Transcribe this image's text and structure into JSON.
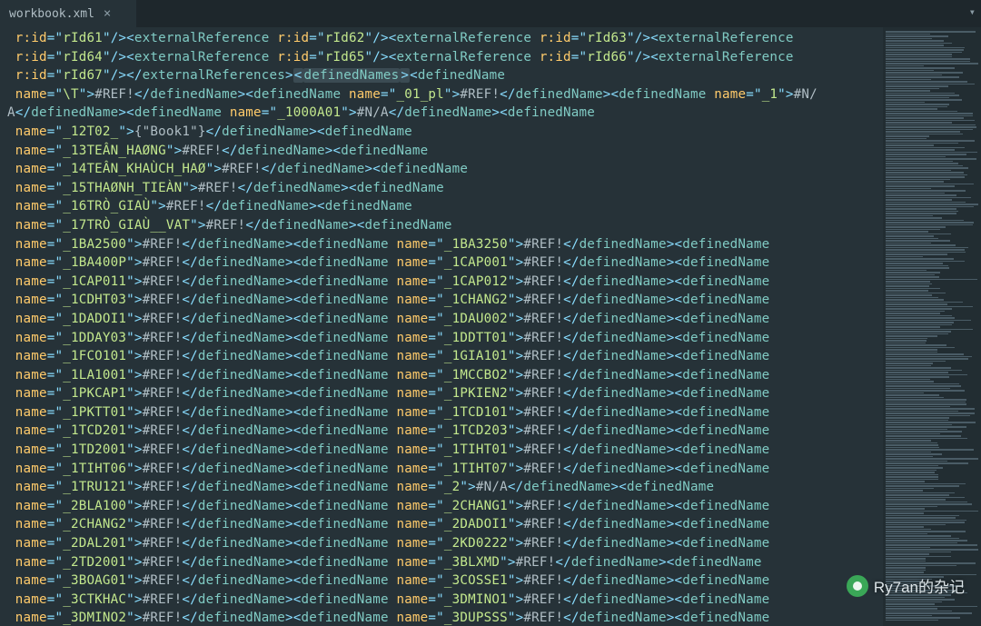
{
  "tab": {
    "title": "workbook.xml"
  },
  "watermark": "Ry7an的杂记",
  "highlighted_segment": "<definedNames>",
  "colors": {
    "background": "#263238",
    "tab_bar": "#1e272c",
    "text": "#b0bec5",
    "tag": "#80cbc4",
    "attr_name": "#ffcb6b",
    "attr_val": "#c3e88d",
    "punct": "#89ddff",
    "highlight": "#3b4b53"
  },
  "tokens": [
    {
      "t": "attr",
      "name": "r:id",
      "val": "rId61"
    },
    {
      "t": "closeSelf"
    },
    {
      "t": "open",
      "name": "externalReference"
    },
    {
      "t": "attr",
      "name": "r:id",
      "val": "rId62"
    },
    {
      "t": "closeSelf"
    },
    {
      "t": "open",
      "name": "externalReference"
    },
    {
      "t": "attr",
      "name": "r:id",
      "val": "rId63"
    },
    {
      "t": "closeSelf"
    },
    {
      "t": "open",
      "name": "externalReference"
    },
    {
      "t": "br"
    },
    {
      "t": "attr",
      "name": "r:id",
      "val": "rId64"
    },
    {
      "t": "closeSelf"
    },
    {
      "t": "open",
      "name": "externalReference"
    },
    {
      "t": "attr",
      "name": "r:id",
      "val": "rId65"
    },
    {
      "t": "closeSelf"
    },
    {
      "t": "open",
      "name": "externalReference"
    },
    {
      "t": "attr",
      "name": "r:id",
      "val": "rId66"
    },
    {
      "t": "closeSelf"
    },
    {
      "t": "open",
      "name": "externalReference"
    },
    {
      "t": "br"
    },
    {
      "t": "attr",
      "name": "r:id",
      "val": "rId67"
    },
    {
      "t": "closeSelf"
    },
    {
      "t": "closeTag",
      "name": "externalReferences"
    },
    {
      "t": "open",
      "name": "definedNames",
      "hl": true
    },
    {
      "t": "gt",
      "hl": true
    },
    {
      "t": "open",
      "name": "definedName"
    },
    {
      "t": "br"
    },
    {
      "t": "attr",
      "name": "name",
      "val": "\\T"
    },
    {
      "t": "gt"
    },
    {
      "t": "text",
      "v": "#REF!"
    },
    {
      "t": "closeTag",
      "name": "definedName"
    },
    {
      "t": "open",
      "name": "definedName"
    },
    {
      "t": "attr",
      "name": "name",
      "val": "_01_pl"
    },
    {
      "t": "gt"
    },
    {
      "t": "text",
      "v": "#REF!"
    },
    {
      "t": "closeTag",
      "name": "definedName"
    },
    {
      "t": "open",
      "name": "definedName"
    },
    {
      "t": "attr",
      "name": "name",
      "val": "_1"
    },
    {
      "t": "gt"
    },
    {
      "t": "text",
      "v": "#N/"
    },
    {
      "t": "br"
    },
    {
      "t": "text",
      "v": "A"
    },
    {
      "t": "closeTag",
      "name": "definedName"
    },
    {
      "t": "open",
      "name": "definedName"
    },
    {
      "t": "attr",
      "name": "name",
      "val": "_1000A01"
    },
    {
      "t": "gt"
    },
    {
      "t": "text",
      "v": "#N/A"
    },
    {
      "t": "closeTag",
      "name": "definedName"
    },
    {
      "t": "open",
      "name": "definedName"
    },
    {
      "t": "br"
    },
    {
      "t": "attr",
      "name": "name",
      "val": "_12T02_"
    },
    {
      "t": "gt"
    },
    {
      "t": "text",
      "v": "{\"Book1\"}"
    },
    {
      "t": "closeTag",
      "name": "definedName"
    },
    {
      "t": "open",
      "name": "definedName"
    },
    {
      "t": "br"
    },
    {
      "t": "attr",
      "name": "name",
      "val": "_13TEÂN_HAØNG"
    },
    {
      "t": "gt"
    },
    {
      "t": "text",
      "v": "#REF!"
    },
    {
      "t": "closeTag",
      "name": "definedName"
    },
    {
      "t": "open",
      "name": "definedName"
    },
    {
      "t": "br"
    },
    {
      "t": "attr",
      "name": "name",
      "val": "_14TEÂN_KHAÙCH_HAØ"
    },
    {
      "t": "gt"
    },
    {
      "t": "text",
      "v": "#REF!"
    },
    {
      "t": "closeTag",
      "name": "definedName"
    },
    {
      "t": "open",
      "name": "definedName"
    },
    {
      "t": "br"
    },
    {
      "t": "attr",
      "name": "name",
      "val": "_15THAØNH_TIEÀN"
    },
    {
      "t": "gt"
    },
    {
      "t": "text",
      "v": "#REF!"
    },
    {
      "t": "closeTag",
      "name": "definedName"
    },
    {
      "t": "open",
      "name": "definedName"
    },
    {
      "t": "br"
    },
    {
      "t": "attr",
      "name": "name",
      "val": "_16TRÒ_GIAÙ"
    },
    {
      "t": "gt"
    },
    {
      "t": "text",
      "v": "#REF!"
    },
    {
      "t": "closeTag",
      "name": "definedName"
    },
    {
      "t": "open",
      "name": "definedName"
    },
    {
      "t": "br"
    },
    {
      "t": "attr",
      "name": "name",
      "val": "_17TRÒ_GIAÙ__VAT"
    },
    {
      "t": "gt"
    },
    {
      "t": "text",
      "v": "#REF!"
    },
    {
      "t": "closeTag",
      "name": "definedName"
    },
    {
      "t": "open",
      "name": "definedName"
    },
    {
      "t": "br"
    },
    {
      "t": "attr",
      "name": "name",
      "val": "_1BA2500"
    },
    {
      "t": "gt"
    },
    {
      "t": "text",
      "v": "#REF!"
    },
    {
      "t": "closeTag",
      "name": "definedName"
    },
    {
      "t": "open",
      "name": "definedName"
    },
    {
      "t": "attr",
      "name": "name",
      "val": "_1BA3250"
    },
    {
      "t": "gt"
    },
    {
      "t": "text",
      "v": "#REF!"
    },
    {
      "t": "closeTag",
      "name": "definedName"
    },
    {
      "t": "open",
      "name": "definedName"
    },
    {
      "t": "br"
    },
    {
      "t": "attr",
      "name": "name",
      "val": "_1BA400P"
    },
    {
      "t": "gt"
    },
    {
      "t": "text",
      "v": "#REF!"
    },
    {
      "t": "closeTag",
      "name": "definedName"
    },
    {
      "t": "open",
      "name": "definedName"
    },
    {
      "t": "attr",
      "name": "name",
      "val": "_1CAP001"
    },
    {
      "t": "gt"
    },
    {
      "t": "text",
      "v": "#REF!"
    },
    {
      "t": "closeTag",
      "name": "definedName"
    },
    {
      "t": "open",
      "name": "definedName"
    },
    {
      "t": "br"
    },
    {
      "t": "attr",
      "name": "name",
      "val": "_1CAP011"
    },
    {
      "t": "gt"
    },
    {
      "t": "text",
      "v": "#REF!"
    },
    {
      "t": "closeTag",
      "name": "definedName"
    },
    {
      "t": "open",
      "name": "definedName"
    },
    {
      "t": "attr",
      "name": "name",
      "val": "_1CAP012"
    },
    {
      "t": "gt"
    },
    {
      "t": "text",
      "v": "#REF!"
    },
    {
      "t": "closeTag",
      "name": "definedName"
    },
    {
      "t": "open",
      "name": "definedName"
    },
    {
      "t": "br"
    },
    {
      "t": "attr",
      "name": "name",
      "val": "_1CDHT03"
    },
    {
      "t": "gt"
    },
    {
      "t": "text",
      "v": "#REF!"
    },
    {
      "t": "closeTag",
      "name": "definedName"
    },
    {
      "t": "open",
      "name": "definedName"
    },
    {
      "t": "attr",
      "name": "name",
      "val": "_1CHANG2"
    },
    {
      "t": "gt"
    },
    {
      "t": "text",
      "v": "#REF!"
    },
    {
      "t": "closeTag",
      "name": "definedName"
    },
    {
      "t": "open",
      "name": "definedName"
    },
    {
      "t": "br"
    },
    {
      "t": "attr",
      "name": "name",
      "val": "_1DADOI1"
    },
    {
      "t": "gt"
    },
    {
      "t": "text",
      "v": "#REF!"
    },
    {
      "t": "closeTag",
      "name": "definedName"
    },
    {
      "t": "open",
      "name": "definedName"
    },
    {
      "t": "attr",
      "name": "name",
      "val": "_1DAU002"
    },
    {
      "t": "gt"
    },
    {
      "t": "text",
      "v": "#REF!"
    },
    {
      "t": "closeTag",
      "name": "definedName"
    },
    {
      "t": "open",
      "name": "definedName"
    },
    {
      "t": "br"
    },
    {
      "t": "attr",
      "name": "name",
      "val": "_1DDAY03"
    },
    {
      "t": "gt"
    },
    {
      "t": "text",
      "v": "#REF!"
    },
    {
      "t": "closeTag",
      "name": "definedName"
    },
    {
      "t": "open",
      "name": "definedName"
    },
    {
      "t": "attr",
      "name": "name",
      "val": "_1DDTT01"
    },
    {
      "t": "gt"
    },
    {
      "t": "text",
      "v": "#REF!"
    },
    {
      "t": "closeTag",
      "name": "definedName"
    },
    {
      "t": "open",
      "name": "definedName"
    },
    {
      "t": "br"
    },
    {
      "t": "attr",
      "name": "name",
      "val": "_1FCO101"
    },
    {
      "t": "gt"
    },
    {
      "t": "text",
      "v": "#REF!"
    },
    {
      "t": "closeTag",
      "name": "definedName"
    },
    {
      "t": "open",
      "name": "definedName"
    },
    {
      "t": "attr",
      "name": "name",
      "val": "_1GIA101"
    },
    {
      "t": "gt"
    },
    {
      "t": "text",
      "v": "#REF!"
    },
    {
      "t": "closeTag",
      "name": "definedName"
    },
    {
      "t": "open",
      "name": "definedName"
    },
    {
      "t": "br"
    },
    {
      "t": "attr",
      "name": "name",
      "val": "_1LA1001"
    },
    {
      "t": "gt"
    },
    {
      "t": "text",
      "v": "#REF!"
    },
    {
      "t": "closeTag",
      "name": "definedName"
    },
    {
      "t": "open",
      "name": "definedName"
    },
    {
      "t": "attr",
      "name": "name",
      "val": "_1MCCBO2"
    },
    {
      "t": "gt"
    },
    {
      "t": "text",
      "v": "#REF!"
    },
    {
      "t": "closeTag",
      "name": "definedName"
    },
    {
      "t": "open",
      "name": "definedName"
    },
    {
      "t": "br"
    },
    {
      "t": "attr",
      "name": "name",
      "val": "_1PKCAP1"
    },
    {
      "t": "gt"
    },
    {
      "t": "text",
      "v": "#REF!"
    },
    {
      "t": "closeTag",
      "name": "definedName"
    },
    {
      "t": "open",
      "name": "definedName"
    },
    {
      "t": "attr",
      "name": "name",
      "val": "_1PKIEN2"
    },
    {
      "t": "gt"
    },
    {
      "t": "text",
      "v": "#REF!"
    },
    {
      "t": "closeTag",
      "name": "definedName"
    },
    {
      "t": "open",
      "name": "definedName"
    },
    {
      "t": "br"
    },
    {
      "t": "attr",
      "name": "name",
      "val": "_1PKTT01"
    },
    {
      "t": "gt"
    },
    {
      "t": "text",
      "v": "#REF!"
    },
    {
      "t": "closeTag",
      "name": "definedName"
    },
    {
      "t": "open",
      "name": "definedName"
    },
    {
      "t": "attr",
      "name": "name",
      "val": "_1TCD101"
    },
    {
      "t": "gt"
    },
    {
      "t": "text",
      "v": "#REF!"
    },
    {
      "t": "closeTag",
      "name": "definedName"
    },
    {
      "t": "open",
      "name": "definedName"
    },
    {
      "t": "br"
    },
    {
      "t": "attr",
      "name": "name",
      "val": "_1TCD201"
    },
    {
      "t": "gt"
    },
    {
      "t": "text",
      "v": "#REF!"
    },
    {
      "t": "closeTag",
      "name": "definedName"
    },
    {
      "t": "open",
      "name": "definedName"
    },
    {
      "t": "attr",
      "name": "name",
      "val": "_1TCD203"
    },
    {
      "t": "gt"
    },
    {
      "t": "text",
      "v": "#REF!"
    },
    {
      "t": "closeTag",
      "name": "definedName"
    },
    {
      "t": "open",
      "name": "definedName"
    },
    {
      "t": "br"
    },
    {
      "t": "attr",
      "name": "name",
      "val": "_1TD2001"
    },
    {
      "t": "gt"
    },
    {
      "t": "text",
      "v": "#REF!"
    },
    {
      "t": "closeTag",
      "name": "definedName"
    },
    {
      "t": "open",
      "name": "definedName"
    },
    {
      "t": "attr",
      "name": "name",
      "val": "_1TIHT01"
    },
    {
      "t": "gt"
    },
    {
      "t": "text",
      "v": "#REF!"
    },
    {
      "t": "closeTag",
      "name": "definedName"
    },
    {
      "t": "open",
      "name": "definedName"
    },
    {
      "t": "br"
    },
    {
      "t": "attr",
      "name": "name",
      "val": "_1TIHT06"
    },
    {
      "t": "gt"
    },
    {
      "t": "text",
      "v": "#REF!"
    },
    {
      "t": "closeTag",
      "name": "definedName"
    },
    {
      "t": "open",
      "name": "definedName"
    },
    {
      "t": "attr",
      "name": "name",
      "val": "_1TIHT07"
    },
    {
      "t": "gt"
    },
    {
      "t": "text",
      "v": "#REF!"
    },
    {
      "t": "closeTag",
      "name": "definedName"
    },
    {
      "t": "open",
      "name": "definedName"
    },
    {
      "t": "br"
    },
    {
      "t": "attr",
      "name": "name",
      "val": "_1TRU121"
    },
    {
      "t": "gt"
    },
    {
      "t": "text",
      "v": "#REF!"
    },
    {
      "t": "closeTag",
      "name": "definedName"
    },
    {
      "t": "open",
      "name": "definedName"
    },
    {
      "t": "attr",
      "name": "name",
      "val": "_2"
    },
    {
      "t": "gt"
    },
    {
      "t": "text",
      "v": "#N/A"
    },
    {
      "t": "closeTag",
      "name": "definedName"
    },
    {
      "t": "open",
      "name": "definedName"
    },
    {
      "t": "br"
    },
    {
      "t": "attr",
      "name": "name",
      "val": "_2BLA100"
    },
    {
      "t": "gt"
    },
    {
      "t": "text",
      "v": "#REF!"
    },
    {
      "t": "closeTag",
      "name": "definedName"
    },
    {
      "t": "open",
      "name": "definedName"
    },
    {
      "t": "attr",
      "name": "name",
      "val": "_2CHANG1"
    },
    {
      "t": "gt"
    },
    {
      "t": "text",
      "v": "#REF!"
    },
    {
      "t": "closeTag",
      "name": "definedName"
    },
    {
      "t": "open",
      "name": "definedName"
    },
    {
      "t": "br"
    },
    {
      "t": "attr",
      "name": "name",
      "val": "_2CHANG2"
    },
    {
      "t": "gt"
    },
    {
      "t": "text",
      "v": "#REF!"
    },
    {
      "t": "closeTag",
      "name": "definedName"
    },
    {
      "t": "open",
      "name": "definedName"
    },
    {
      "t": "attr",
      "name": "name",
      "val": "_2DADOI1"
    },
    {
      "t": "gt"
    },
    {
      "t": "text",
      "v": "#REF!"
    },
    {
      "t": "closeTag",
      "name": "definedName"
    },
    {
      "t": "open",
      "name": "definedName"
    },
    {
      "t": "br"
    },
    {
      "t": "attr",
      "name": "name",
      "val": "_2DAL201"
    },
    {
      "t": "gt"
    },
    {
      "t": "text",
      "v": "#REF!"
    },
    {
      "t": "closeTag",
      "name": "definedName"
    },
    {
      "t": "open",
      "name": "definedName"
    },
    {
      "t": "attr",
      "name": "name",
      "val": "_2KD0222"
    },
    {
      "t": "gt"
    },
    {
      "t": "text",
      "v": "#REF!"
    },
    {
      "t": "closeTag",
      "name": "definedName"
    },
    {
      "t": "open",
      "name": "definedName"
    },
    {
      "t": "br"
    },
    {
      "t": "attr",
      "name": "name",
      "val": "_2TD2001"
    },
    {
      "t": "gt"
    },
    {
      "t": "text",
      "v": "#REF!"
    },
    {
      "t": "closeTag",
      "name": "definedName"
    },
    {
      "t": "open",
      "name": "definedName"
    },
    {
      "t": "attr",
      "name": "name",
      "val": "_3BLXMD"
    },
    {
      "t": "gt"
    },
    {
      "t": "text",
      "v": "#REF!"
    },
    {
      "t": "closeTag",
      "name": "definedName"
    },
    {
      "t": "open",
      "name": "definedName"
    },
    {
      "t": "br"
    },
    {
      "t": "attr",
      "name": "name",
      "val": "_3BOAG01"
    },
    {
      "t": "gt"
    },
    {
      "t": "text",
      "v": "#REF!"
    },
    {
      "t": "closeTag",
      "name": "definedName"
    },
    {
      "t": "open",
      "name": "definedName"
    },
    {
      "t": "attr",
      "name": "name",
      "val": "_3COSSE1"
    },
    {
      "t": "gt"
    },
    {
      "t": "text",
      "v": "#REF!"
    },
    {
      "t": "closeTag",
      "name": "definedName"
    },
    {
      "t": "open",
      "name": "definedName"
    },
    {
      "t": "br"
    },
    {
      "t": "attr",
      "name": "name",
      "val": "_3CTKHAC"
    },
    {
      "t": "gt"
    },
    {
      "t": "text",
      "v": "#REF!"
    },
    {
      "t": "closeTag",
      "name": "definedName"
    },
    {
      "t": "open",
      "name": "definedName"
    },
    {
      "t": "attr",
      "name": "name",
      "val": "_3DMINO1"
    },
    {
      "t": "gt"
    },
    {
      "t": "text",
      "v": "#REF!"
    },
    {
      "t": "closeTag",
      "name": "definedName"
    },
    {
      "t": "open",
      "name": "definedName"
    },
    {
      "t": "br"
    },
    {
      "t": "attr",
      "name": "name",
      "val": "_3DMINO2"
    },
    {
      "t": "gt"
    },
    {
      "t": "text",
      "v": "#REF!"
    },
    {
      "t": "closeTag",
      "name": "definedName"
    },
    {
      "t": "open",
      "name": "definedName"
    },
    {
      "t": "attr",
      "name": "name",
      "val": "_3DUPSSS"
    },
    {
      "t": "gt"
    },
    {
      "t": "text",
      "v": "#REF!"
    },
    {
      "t": "closeTag",
      "name": "definedName"
    },
    {
      "t": "open",
      "name": "definedName"
    }
  ]
}
